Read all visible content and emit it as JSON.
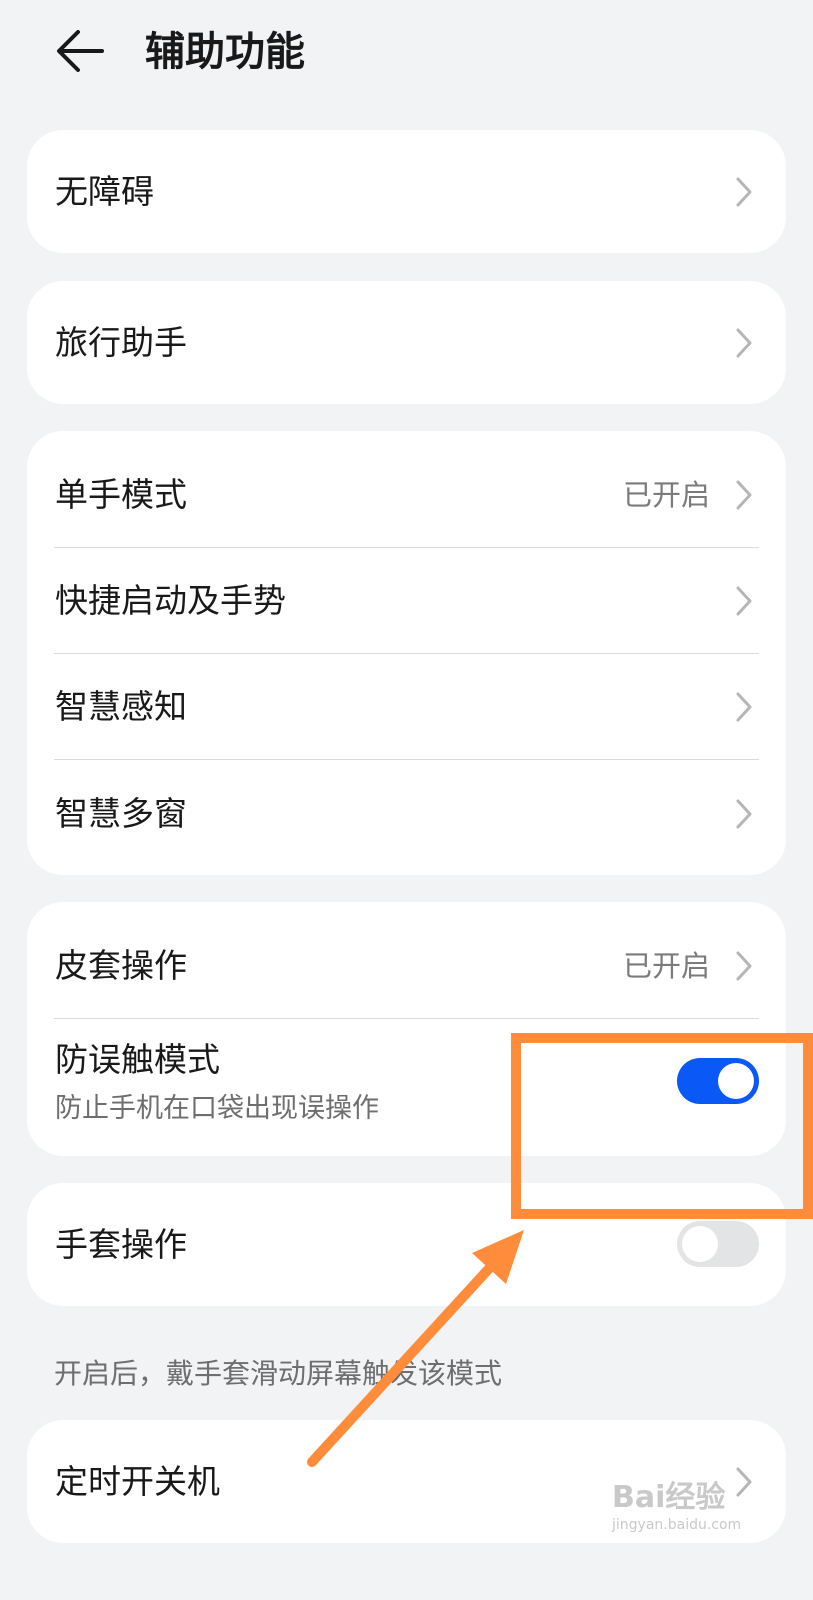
{
  "header": {
    "title": "辅助功能",
    "back_icon": "arrow-left-icon"
  },
  "cards": [
    {
      "items": [
        {
          "label": "无障碍"
        }
      ]
    },
    {
      "items": [
        {
          "label": "旅行助手"
        }
      ]
    },
    {
      "items": [
        {
          "label": "单手模式",
          "value": "已开启"
        },
        {
          "label": "快捷启动及手势"
        },
        {
          "label": "智慧感知"
        },
        {
          "label": "智慧多窗"
        }
      ]
    },
    {
      "items": [
        {
          "label": "皮套操作",
          "value": "已开启"
        },
        {
          "label": "防误触模式",
          "subtitle": "防止手机在口袋出现误操作",
          "toggle": "on"
        }
      ]
    },
    {
      "items": [
        {
          "label": "手套操作",
          "toggle": "off"
        }
      ]
    }
  ],
  "glove_note": "开启后，戴手套滑动屏幕触发该模式",
  "timer_card": {
    "label": "定时开关机"
  },
  "annotation": {
    "color": "#ff8c3a",
    "shape": "highlight-box-with-arrow"
  },
  "toggle_on_color": "#0a59f7",
  "watermark": {
    "main": "Bai经验",
    "sub": "jingyan.baidu.com"
  }
}
